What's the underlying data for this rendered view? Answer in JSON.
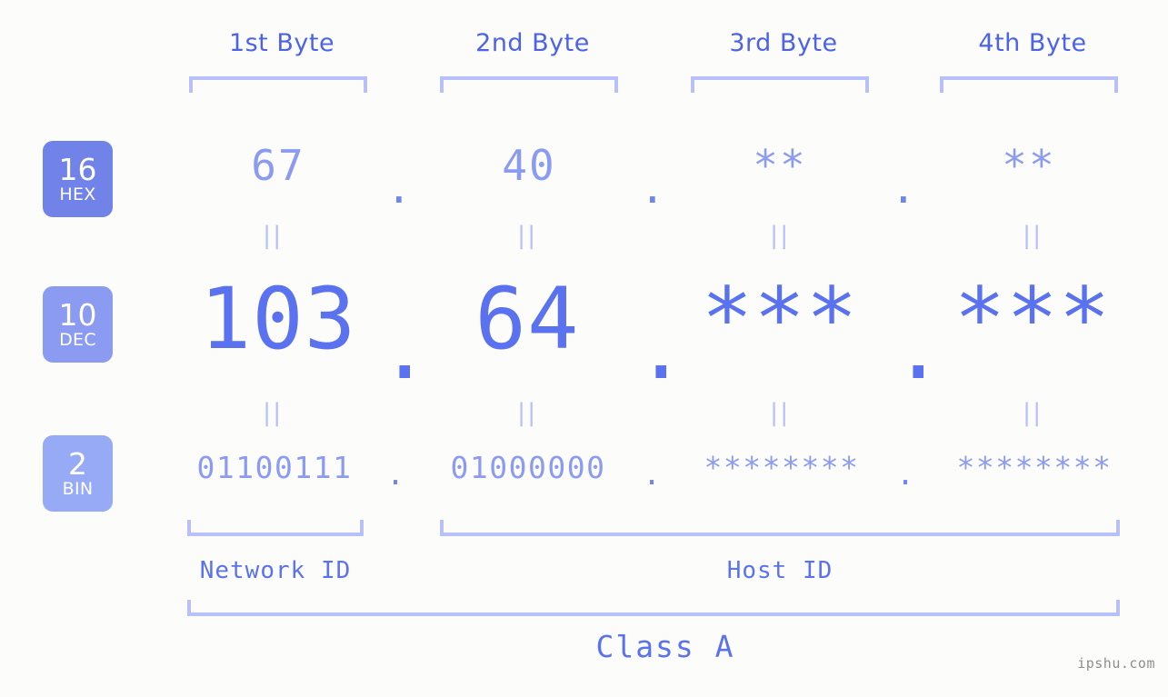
{
  "watermark": "ipshu.com",
  "byte_headers": [
    {
      "label": "1st Byte"
    },
    {
      "label": "2nd Byte"
    },
    {
      "label": "3rd Byte"
    },
    {
      "label": "4th Byte"
    }
  ],
  "radix_badges": [
    {
      "number": "16",
      "name": "HEX",
      "color": "#7182e9"
    },
    {
      "number": "10",
      "name": "DEC",
      "color": "#8b9bf2"
    },
    {
      "number": "2",
      "name": "BIN",
      "color": "#97aaf6"
    }
  ],
  "rows": {
    "hex": {
      "radix": "16",
      "radix_name": "HEX",
      "values": [
        "67",
        "40",
        "**",
        "**"
      ],
      "separators": [
        ".",
        ".",
        "."
      ]
    },
    "dec": {
      "radix": "10",
      "radix_name": "DEC",
      "values": [
        "103",
        "64",
        "***",
        "***"
      ],
      "separators": [
        ".",
        ".",
        "."
      ]
    },
    "bin": {
      "radix": "2",
      "radix_name": "BIN",
      "values": [
        "01100111",
        "01000000",
        "********",
        "********"
      ],
      "separators": [
        ".",
        ".",
        "."
      ]
    }
  },
  "equality_marks": [
    "||",
    "||",
    "||",
    "||",
    "||",
    "||",
    "||",
    "||"
  ],
  "sections": [
    {
      "label": "Network ID"
    },
    {
      "label": "Host ID"
    }
  ],
  "class": {
    "label": "Class A"
  },
  "colors": {
    "background": "#fcfdfa",
    "header_text": "#4c62e8",
    "bracket": "#b7c0fb",
    "hex_value": "#8b9bf2",
    "dec_value": "#5a72ef",
    "bin_value": "#8b9bf2",
    "badge_hex": "#7182e9",
    "badge_dec": "#8b9bf2",
    "badge_bin": "#97aaf6",
    "watermark": "#8d8d8d"
  }
}
